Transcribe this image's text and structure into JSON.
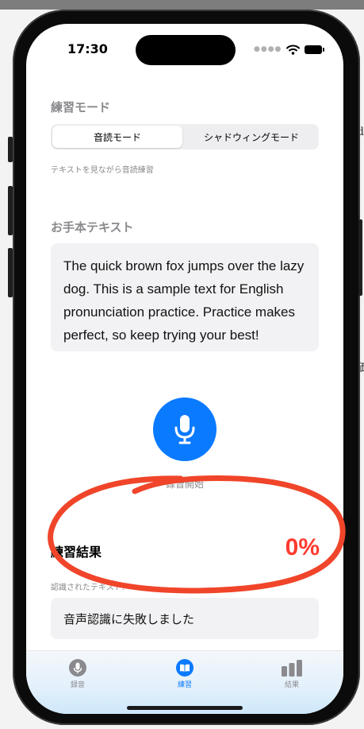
{
  "status_bar": {
    "time": "17:30"
  },
  "practice_mode": {
    "title": "練習モード",
    "options": [
      "音読モード",
      "シャドウィングモード"
    ],
    "selected": "音読モード",
    "caption": "テキストを見ながら音読練習"
  },
  "model_text": {
    "title": "お手本テキスト",
    "body": "The quick brown fox jumps over the lazy dog. This is a sample text for English pronunciation practice. Practice makes perfect, so keep trying your best!"
  },
  "record": {
    "label": "録音開始"
  },
  "result": {
    "title": "練習結果",
    "score": "0%",
    "recognized_label": "認識されたテキスト:",
    "recognized_text": "音声認識に失敗しました"
  },
  "tabs": [
    {
      "label": "録音",
      "icon": "mic-circle-icon"
    },
    {
      "label": "練習",
      "icon": "book-circle-icon"
    },
    {
      "label": "結果",
      "icon": "bar-chart-icon"
    }
  ],
  "colors": {
    "accent": "#0a7aff",
    "score": "#ff3b30",
    "annotation": "#f0452a"
  },
  "background_fragments": [
    "d",
    "価"
  ]
}
